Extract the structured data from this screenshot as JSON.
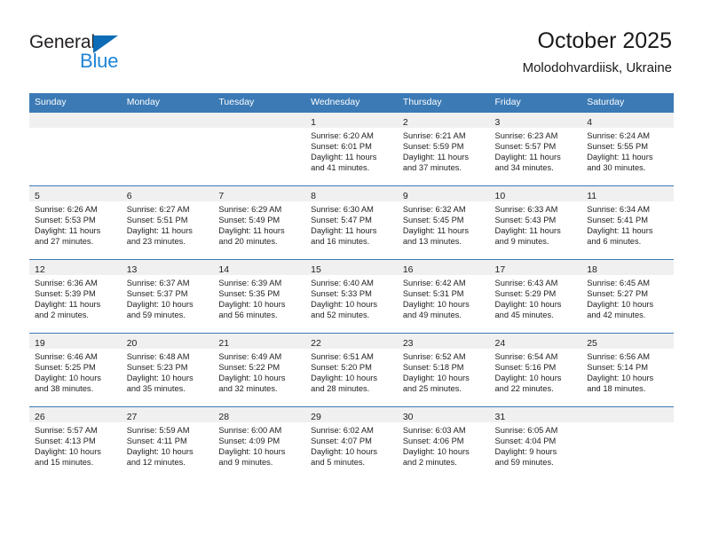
{
  "logo": {
    "word_top": "General",
    "word_bottom": "Blue",
    "triangle_icon": "logo-triangle-icon",
    "color_dark": "#231f20",
    "color_blue": "#1f84d6"
  },
  "header": {
    "title": "October 2025",
    "subtitle": "Molodohvardiisk, Ukraine"
  },
  "theme": {
    "header_blue": "#3b7ab5",
    "daynum_band": "#f0f0f0",
    "text": "#222222"
  },
  "calendar": {
    "weekday_headers": [
      "Sunday",
      "Monday",
      "Tuesday",
      "Wednesday",
      "Thursday",
      "Friday",
      "Saturday"
    ],
    "weeks": [
      [
        {
          "day": "",
          "lines": []
        },
        {
          "day": "",
          "lines": []
        },
        {
          "day": "",
          "lines": []
        },
        {
          "day": "1",
          "lines": [
            "Sunrise: 6:20 AM",
            "Sunset: 6:01 PM",
            "Daylight: 11 hours",
            "and 41 minutes."
          ]
        },
        {
          "day": "2",
          "lines": [
            "Sunrise: 6:21 AM",
            "Sunset: 5:59 PM",
            "Daylight: 11 hours",
            "and 37 minutes."
          ]
        },
        {
          "day": "3",
          "lines": [
            "Sunrise: 6:23 AM",
            "Sunset: 5:57 PM",
            "Daylight: 11 hours",
            "and 34 minutes."
          ]
        },
        {
          "day": "4",
          "lines": [
            "Sunrise: 6:24 AM",
            "Sunset: 5:55 PM",
            "Daylight: 11 hours",
            "and 30 minutes."
          ]
        }
      ],
      [
        {
          "day": "5",
          "lines": [
            "Sunrise: 6:26 AM",
            "Sunset: 5:53 PM",
            "Daylight: 11 hours",
            "and 27 minutes."
          ]
        },
        {
          "day": "6",
          "lines": [
            "Sunrise: 6:27 AM",
            "Sunset: 5:51 PM",
            "Daylight: 11 hours",
            "and 23 minutes."
          ]
        },
        {
          "day": "7",
          "lines": [
            "Sunrise: 6:29 AM",
            "Sunset: 5:49 PM",
            "Daylight: 11 hours",
            "and 20 minutes."
          ]
        },
        {
          "day": "8",
          "lines": [
            "Sunrise: 6:30 AM",
            "Sunset: 5:47 PM",
            "Daylight: 11 hours",
            "and 16 minutes."
          ]
        },
        {
          "day": "9",
          "lines": [
            "Sunrise: 6:32 AM",
            "Sunset: 5:45 PM",
            "Daylight: 11 hours",
            "and 13 minutes."
          ]
        },
        {
          "day": "10",
          "lines": [
            "Sunrise: 6:33 AM",
            "Sunset: 5:43 PM",
            "Daylight: 11 hours",
            "and 9 minutes."
          ]
        },
        {
          "day": "11",
          "lines": [
            "Sunrise: 6:34 AM",
            "Sunset: 5:41 PM",
            "Daylight: 11 hours",
            "and 6 minutes."
          ]
        }
      ],
      [
        {
          "day": "12",
          "lines": [
            "Sunrise: 6:36 AM",
            "Sunset: 5:39 PM",
            "Daylight: 11 hours",
            "and 2 minutes."
          ]
        },
        {
          "day": "13",
          "lines": [
            "Sunrise: 6:37 AM",
            "Sunset: 5:37 PM",
            "Daylight: 10 hours",
            "and 59 minutes."
          ]
        },
        {
          "day": "14",
          "lines": [
            "Sunrise: 6:39 AM",
            "Sunset: 5:35 PM",
            "Daylight: 10 hours",
            "and 56 minutes."
          ]
        },
        {
          "day": "15",
          "lines": [
            "Sunrise: 6:40 AM",
            "Sunset: 5:33 PM",
            "Daylight: 10 hours",
            "and 52 minutes."
          ]
        },
        {
          "day": "16",
          "lines": [
            "Sunrise: 6:42 AM",
            "Sunset: 5:31 PM",
            "Daylight: 10 hours",
            "and 49 minutes."
          ]
        },
        {
          "day": "17",
          "lines": [
            "Sunrise: 6:43 AM",
            "Sunset: 5:29 PM",
            "Daylight: 10 hours",
            "and 45 minutes."
          ]
        },
        {
          "day": "18",
          "lines": [
            "Sunrise: 6:45 AM",
            "Sunset: 5:27 PM",
            "Daylight: 10 hours",
            "and 42 minutes."
          ]
        }
      ],
      [
        {
          "day": "19",
          "lines": [
            "Sunrise: 6:46 AM",
            "Sunset: 5:25 PM",
            "Daylight: 10 hours",
            "and 38 minutes."
          ]
        },
        {
          "day": "20",
          "lines": [
            "Sunrise: 6:48 AM",
            "Sunset: 5:23 PM",
            "Daylight: 10 hours",
            "and 35 minutes."
          ]
        },
        {
          "day": "21",
          "lines": [
            "Sunrise: 6:49 AM",
            "Sunset: 5:22 PM",
            "Daylight: 10 hours",
            "and 32 minutes."
          ]
        },
        {
          "day": "22",
          "lines": [
            "Sunrise: 6:51 AM",
            "Sunset: 5:20 PM",
            "Daylight: 10 hours",
            "and 28 minutes."
          ]
        },
        {
          "day": "23",
          "lines": [
            "Sunrise: 6:52 AM",
            "Sunset: 5:18 PM",
            "Daylight: 10 hours",
            "and 25 minutes."
          ]
        },
        {
          "day": "24",
          "lines": [
            "Sunrise: 6:54 AM",
            "Sunset: 5:16 PM",
            "Daylight: 10 hours",
            "and 22 minutes."
          ]
        },
        {
          "day": "25",
          "lines": [
            "Sunrise: 6:56 AM",
            "Sunset: 5:14 PM",
            "Daylight: 10 hours",
            "and 18 minutes."
          ]
        }
      ],
      [
        {
          "day": "26",
          "lines": [
            "Sunrise: 5:57 AM",
            "Sunset: 4:13 PM",
            "Daylight: 10 hours",
            "and 15 minutes."
          ]
        },
        {
          "day": "27",
          "lines": [
            "Sunrise: 5:59 AM",
            "Sunset: 4:11 PM",
            "Daylight: 10 hours",
            "and 12 minutes."
          ]
        },
        {
          "day": "28",
          "lines": [
            "Sunrise: 6:00 AM",
            "Sunset: 4:09 PM",
            "Daylight: 10 hours",
            "and 9 minutes."
          ]
        },
        {
          "day": "29",
          "lines": [
            "Sunrise: 6:02 AM",
            "Sunset: 4:07 PM",
            "Daylight: 10 hours",
            "and 5 minutes."
          ]
        },
        {
          "day": "30",
          "lines": [
            "Sunrise: 6:03 AM",
            "Sunset: 4:06 PM",
            "Daylight: 10 hours",
            "and 2 minutes."
          ]
        },
        {
          "day": "31",
          "lines": [
            "Sunrise: 6:05 AM",
            "Sunset: 4:04 PM",
            "Daylight: 9 hours",
            "and 59 minutes."
          ]
        },
        {
          "day": "",
          "lines": []
        }
      ]
    ]
  }
}
